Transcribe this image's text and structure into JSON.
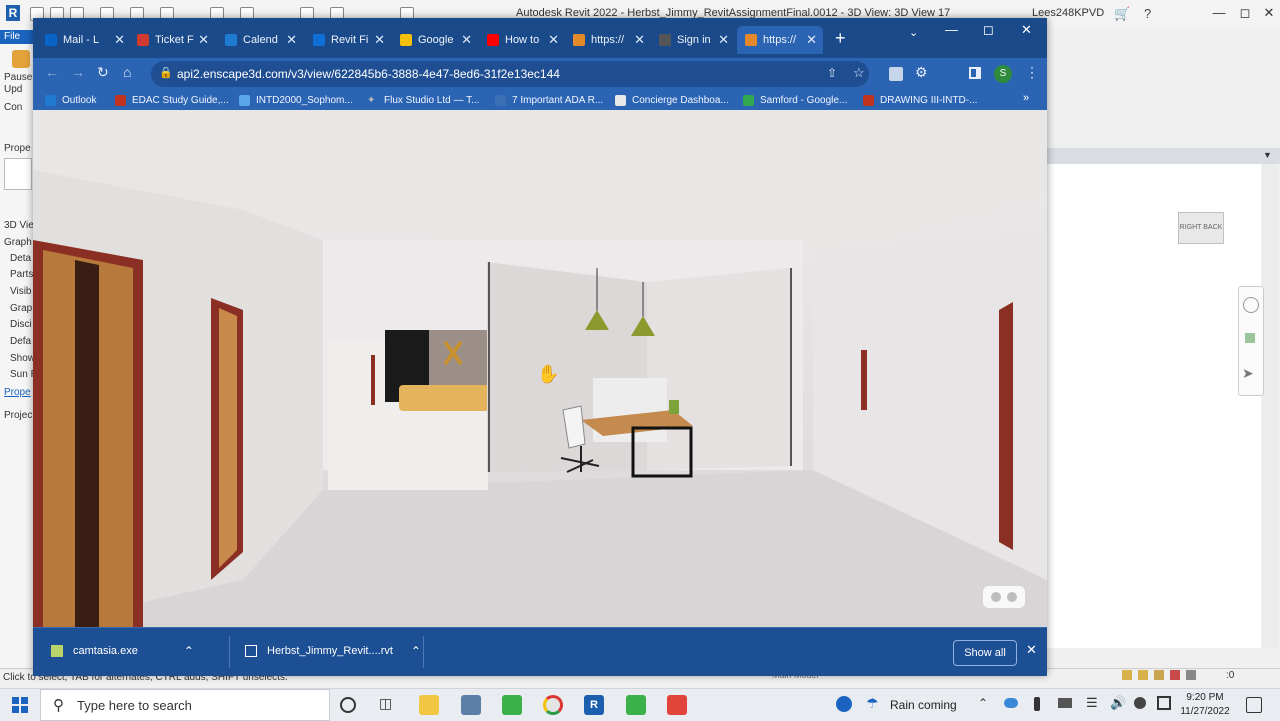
{
  "revit": {
    "title": "Autodesk Revit 2022 - Herbst_Jimmy_RevitAssignmentFinal.0012 - 3D View: 3D View 17",
    "user": "Lees248KPVD",
    "file_tab": "File",
    "left_labels": [
      "Pause",
      "Upd",
      "Con",
      "Prope",
      "3D Vie",
      "Graph",
      "Deta",
      "Parts",
      "Visib",
      "Grap",
      "Disci",
      "Defa",
      "Show",
      "Sun P",
      "Prope",
      "Projec"
    ],
    "viewcube_label": "RIGHT  BACK",
    "status_text": "Click to select, TAB for alternates, CTRL adds, SHIFT unselects.",
    "main_model": "Main Model",
    "filter_count": ":0"
  },
  "browser": {
    "tabs": [
      {
        "label": "Mail - L",
        "color": "#0a64c8"
      },
      {
        "label": "Ticket F",
        "color": "#d23b2f"
      },
      {
        "label": "Calend",
        "color": "#1f7ad1"
      },
      {
        "label": "Revit Fi",
        "color": "#0f6fd6"
      },
      {
        "label": "Google",
        "color": "#f4c20d"
      },
      {
        "label": "How to",
        "color": "#ff0000"
      },
      {
        "label": "https://",
        "color": "#e58a2a"
      },
      {
        "label": "Sign in",
        "color": "#555555"
      },
      {
        "label": "https://",
        "color": "#e58a2a"
      }
    ],
    "url": "api2.enscape3d.com/v3/view/622845b6-3888-4e47-8ed6-31f2e13ec144",
    "profile_letter": "S",
    "bookmarks": [
      {
        "label": "Outlook",
        "color": "#1f7ad1"
      },
      {
        "label": "EDAC Study Guide,...",
        "color": "#c2331f"
      },
      {
        "label": "INTD2000_Sophom...",
        "color": "#5aa6e8"
      },
      {
        "label": "Flux Studio Ltd — T...",
        "color": "#7a7a7a"
      },
      {
        "label": "7 Important ADA R...",
        "color": "#3b6fb5"
      },
      {
        "label": "Concierge Dashboa...",
        "color": "#e8e8e8"
      },
      {
        "label": "Samford - Google...",
        "color": "#2fa84f"
      },
      {
        "label": "DRAWING III-INTD-...",
        "color": "#c2331f"
      }
    ],
    "downloads": [
      {
        "label": "camtasia.exe"
      },
      {
        "label": "Herbst_Jimmy_Revit....rvt"
      }
    ],
    "show_all": "Show all"
  },
  "taskbar": {
    "search_placeholder": "Type here to search",
    "weather": "Rain coming",
    "time": "9:20 PM",
    "date": "11/27/2022"
  }
}
